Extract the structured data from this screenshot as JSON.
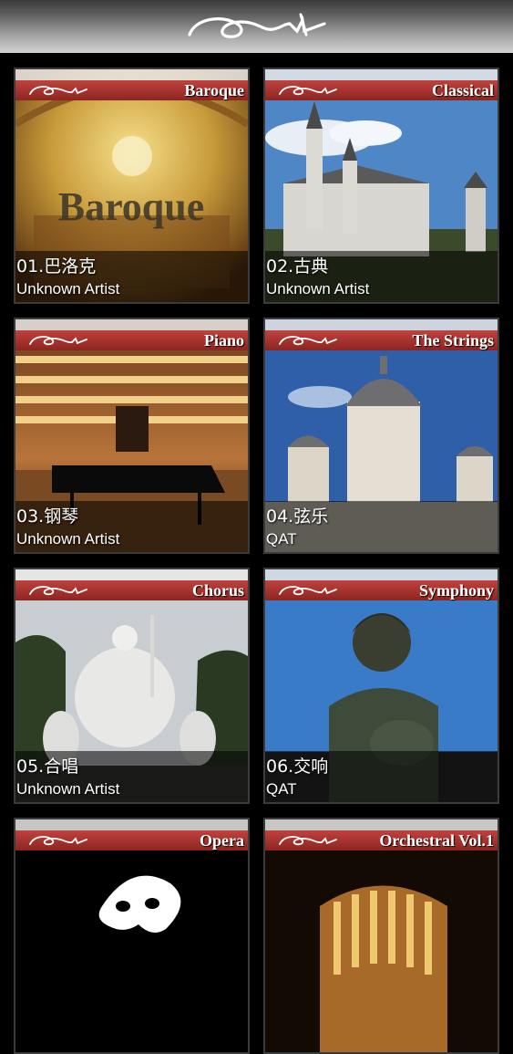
{
  "app": {
    "logo_icon": "ort-script-logo"
  },
  "albums": [
    {
      "genre": "Baroque",
      "title": "01.巴洛克",
      "artist": "Unknown Artist",
      "art": "baroque-ceiling"
    },
    {
      "genre": "Classical",
      "title": "02.古典",
      "artist": "Unknown Artist",
      "art": "castle"
    },
    {
      "genre": "Piano",
      "title": "03.钢琴",
      "artist": "Unknown Artist",
      "art": "concert-hall-piano"
    },
    {
      "genre": "The Strings",
      "title": "04.弦乐",
      "artist": "QAT",
      "art": "domed-building"
    },
    {
      "genre": "Chorus",
      "title": "05.合唱",
      "artist": "Unknown Artist",
      "art": "fountain-statues"
    },
    {
      "genre": "Symphony",
      "title": "06.交响",
      "artist": "QAT",
      "art": "beethoven-statue"
    },
    {
      "genre": "Opera",
      "title": "",
      "artist": "",
      "art": "opera-mask"
    },
    {
      "genre": "Orchestral Vol.1",
      "title": "",
      "artist": "",
      "art": "golden-hall"
    }
  ]
}
